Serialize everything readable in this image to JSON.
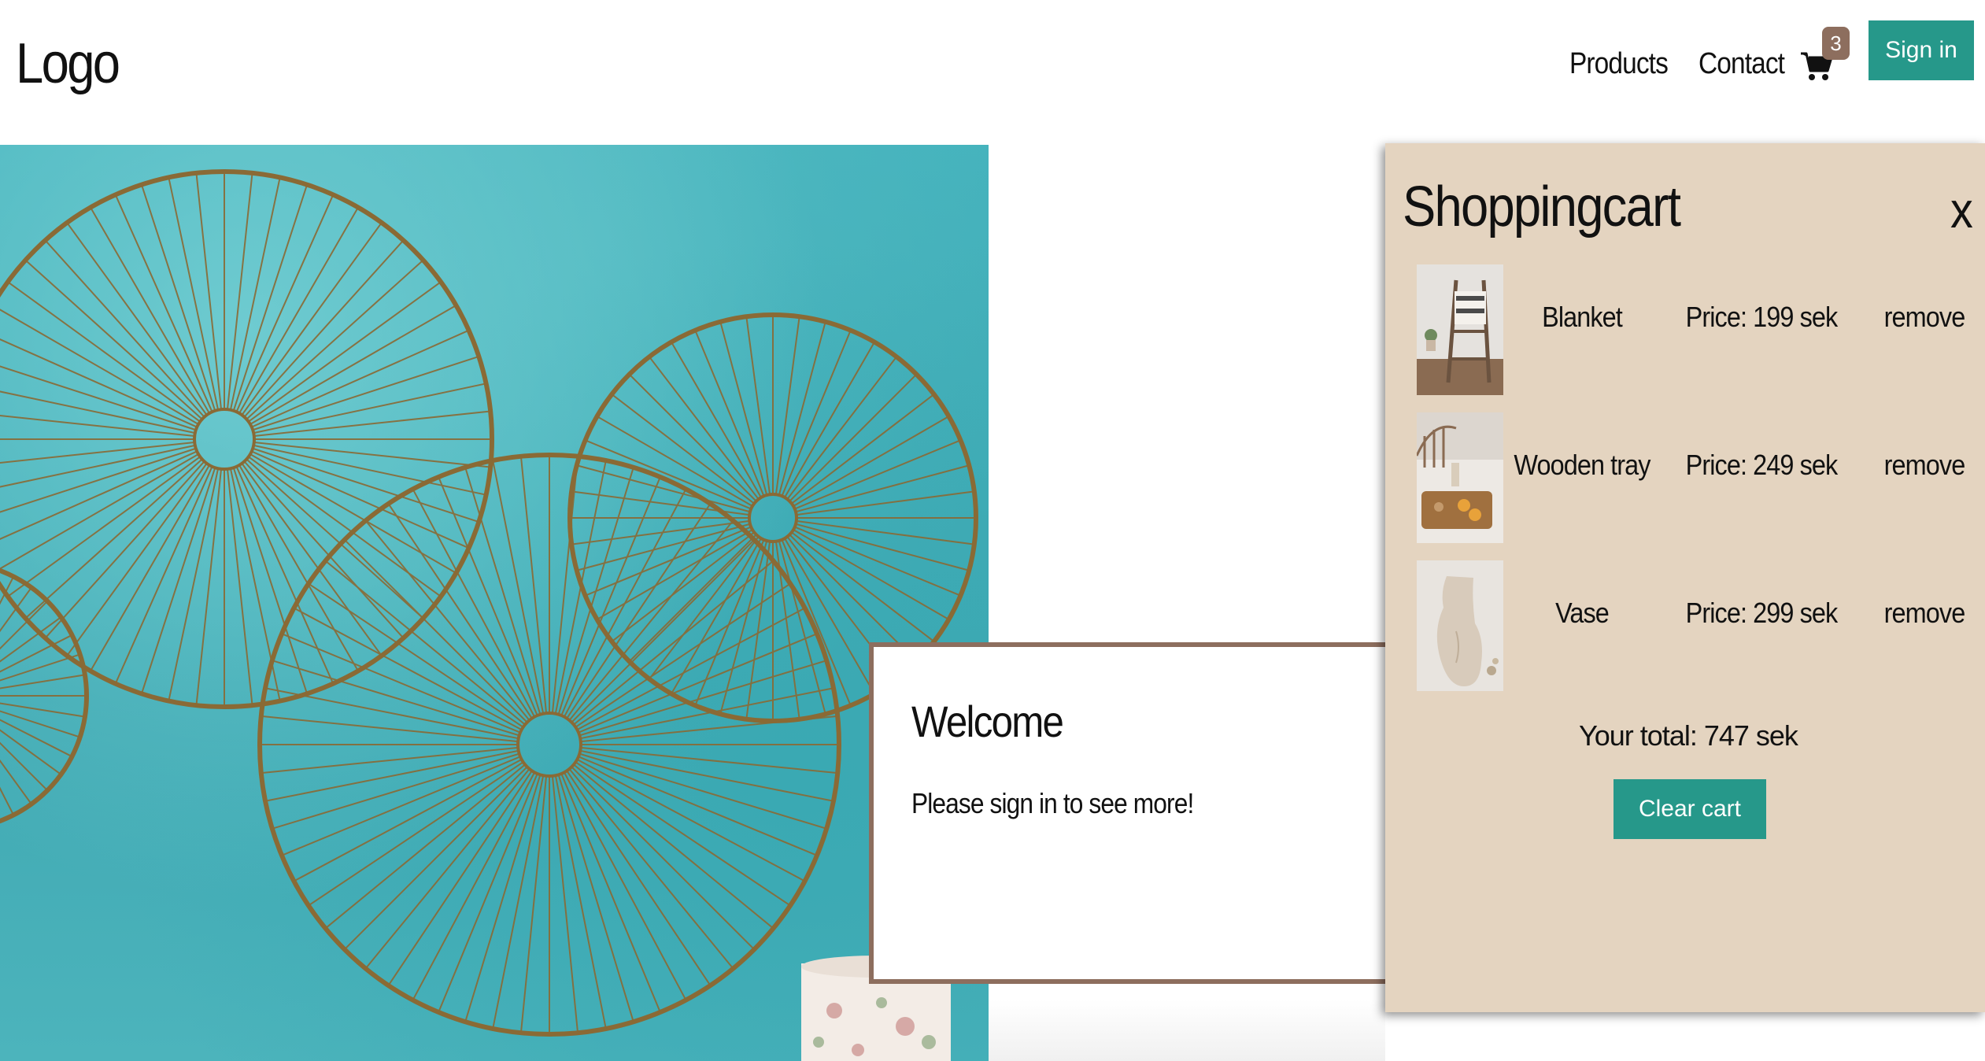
{
  "header": {
    "logo": "Logo",
    "nav": {
      "products": "Products",
      "contact": "Contact"
    },
    "cart_count": "3",
    "signin_label": "Sign in",
    "accent_color": "#26988a",
    "badge_color": "#8d6e5e"
  },
  "welcome": {
    "title": "Welcome",
    "text": "Please sign in to see more!"
  },
  "cart": {
    "title": "Shoppingcart",
    "close": "x",
    "items": [
      {
        "name": "Blanket",
        "price": "Price: 199 sek",
        "remove": "remove",
        "image": "blanket-ladder-photo"
      },
      {
        "name": "Wooden tray",
        "price": "Price: 249 sek",
        "remove": "remove",
        "image": "wooden-tray-photo"
      },
      {
        "name": "Vase",
        "price": "Price: 299 sek",
        "remove": "remove",
        "image": "vase-photo"
      }
    ],
    "total": "Your total: 747 sek",
    "clear_label": "Clear cart",
    "background": "#e4d4c0"
  },
  "icons": {
    "cart": "cart-icon"
  }
}
